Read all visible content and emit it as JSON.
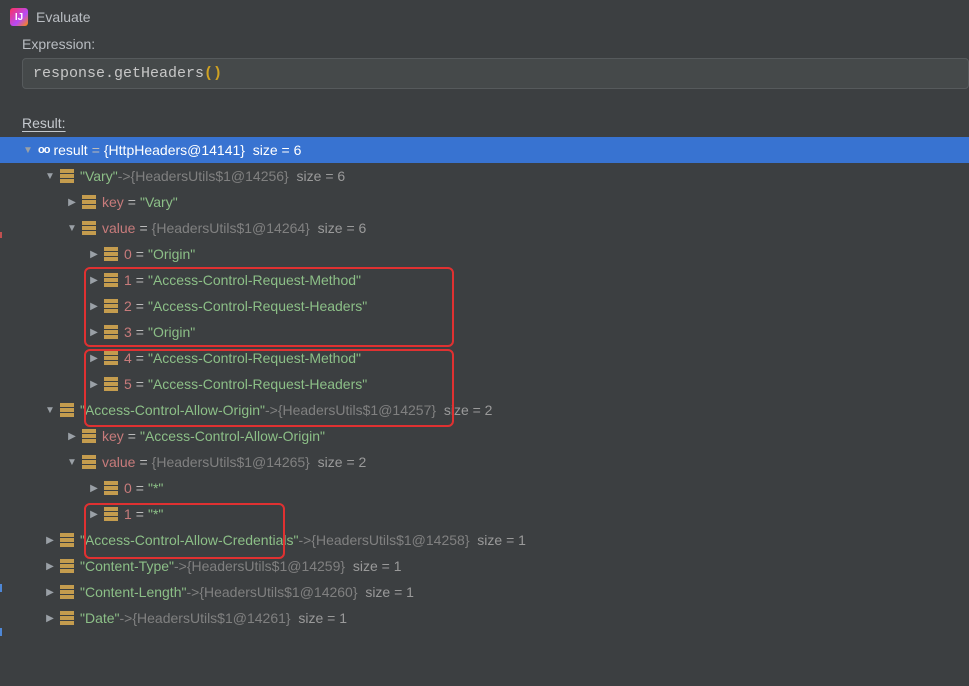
{
  "window": {
    "title": "Evaluate"
  },
  "labels": {
    "expression": "Expression:",
    "result": "Result:"
  },
  "expression": {
    "text": "response.getHeaders",
    "parens": "()"
  },
  "resultRoot": {
    "name": "result",
    "obj": "{HttpHeaders@14141}",
    "size": "size = 6"
  },
  "entries": [
    {
      "keyStr": "\"Vary\"",
      "obj": "{HeadersUtils$1@14256}",
      "size": "size = 6",
      "key": {
        "label": "key",
        "val": "\"Vary\""
      },
      "valueMeta": {
        "label": "value",
        "obj": "{HeadersUtils$1@14264}",
        "size": "size = 6"
      },
      "values": [
        {
          "idx": "0",
          "val": "\"Origin\""
        },
        {
          "idx": "1",
          "val": "\"Access-Control-Request-Method\""
        },
        {
          "idx": "2",
          "val": "\"Access-Control-Request-Headers\""
        },
        {
          "idx": "3",
          "val": "\"Origin\""
        },
        {
          "idx": "4",
          "val": "\"Access-Control-Request-Method\""
        },
        {
          "idx": "5",
          "val": "\"Access-Control-Request-Headers\""
        }
      ]
    },
    {
      "keyStr": "\"Access-Control-Allow-Origin\"",
      "obj": "{HeadersUtils$1@14257}",
      "size": "size = 2",
      "key": {
        "label": "key",
        "val": "\"Access-Control-Allow-Origin\""
      },
      "valueMeta": {
        "label": "value",
        "obj": "{HeadersUtils$1@14265}",
        "size": "size = 2"
      },
      "values": [
        {
          "idx": "0",
          "val": "\"*\""
        },
        {
          "idx": "1",
          "val": "\"*\""
        }
      ]
    },
    {
      "keyStr": "\"Access-Control-Allow-Credentials\"",
      "obj": "{HeadersUtils$1@14258}",
      "size": "size = 1"
    },
    {
      "keyStr": "\"Content-Type\"",
      "obj": "{HeadersUtils$1@14259}",
      "size": "size = 1"
    },
    {
      "keyStr": "\"Content-Length\"",
      "obj": "{HeadersUtils$1@14260}",
      "size": "size = 1"
    },
    {
      "keyStr": "\"Date\"",
      "obj": "{HeadersUtils$1@14261}",
      "size": "size = 1"
    }
  ],
  "arrowSep": " -> "
}
